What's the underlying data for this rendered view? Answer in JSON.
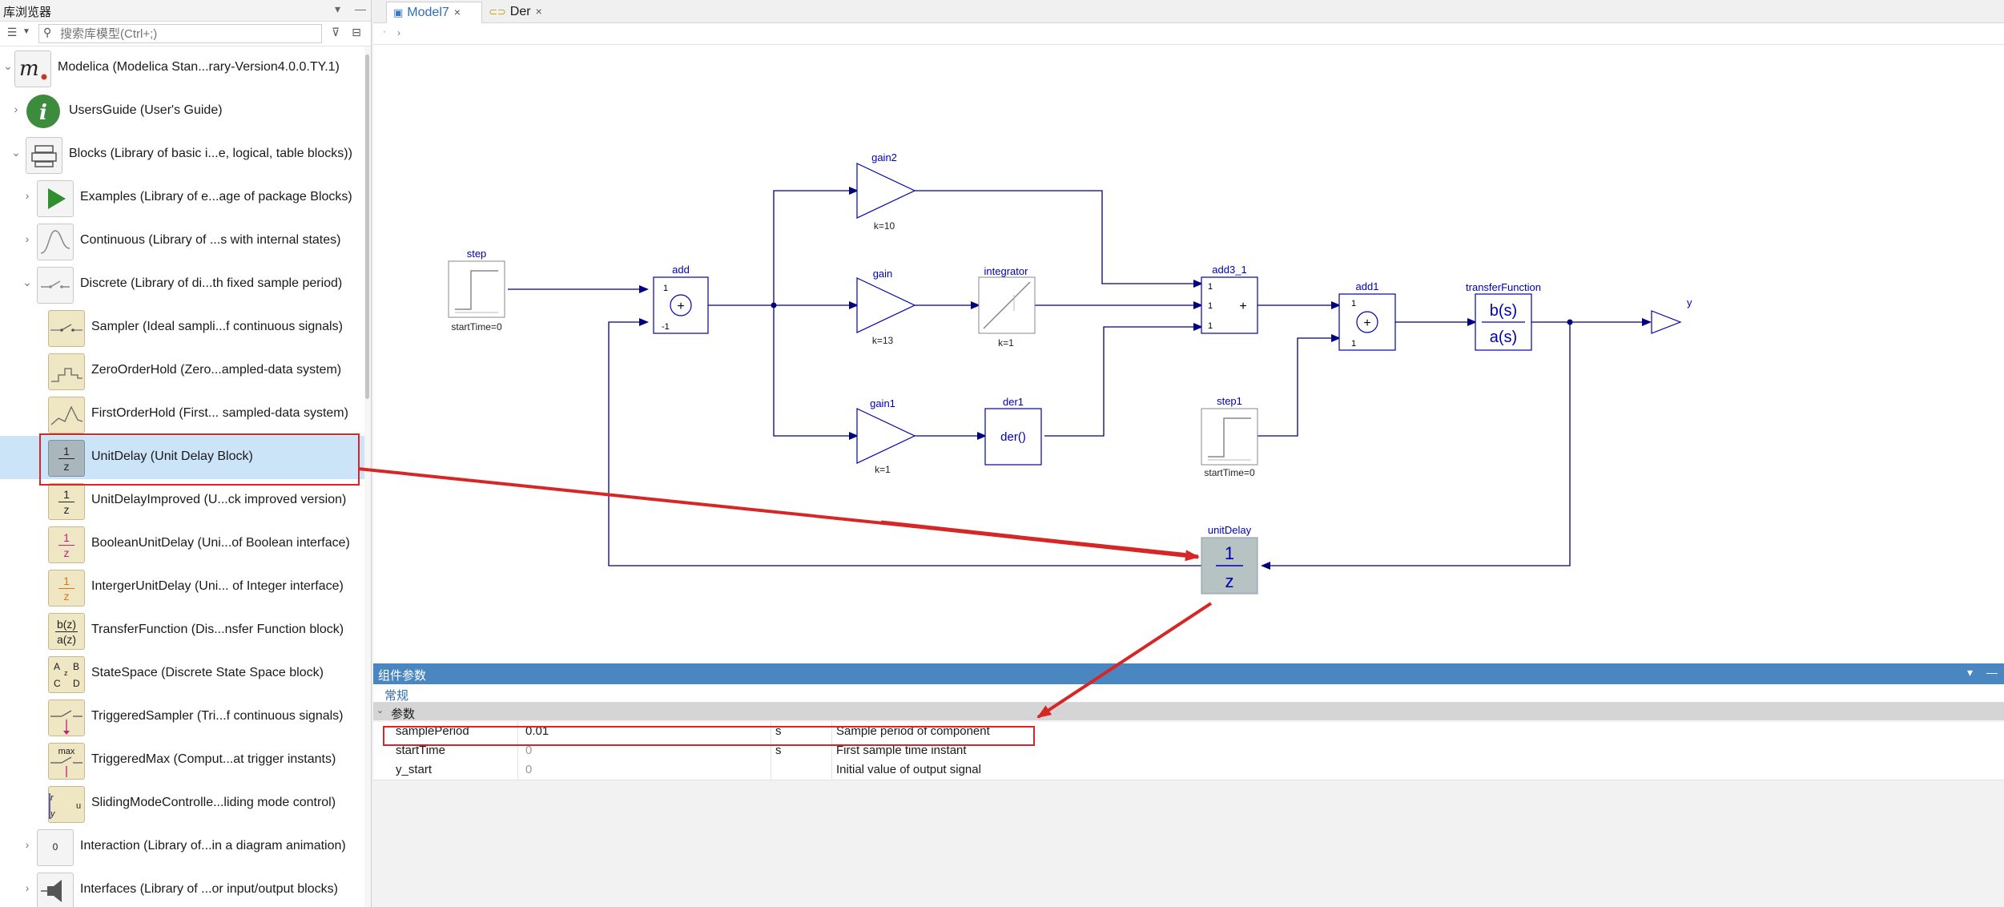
{
  "library": {
    "title": "库浏览器",
    "search_placeholder": "搜索库模型(Ctrl+;)",
    "items": [
      {
        "label": "Modelica (Modelica Stan...rary-Version4.0.0.TY.1)",
        "icon": "modelica-logo-icon",
        "expanded": true
      },
      {
        "label": "UsersGuide (User's Guide)",
        "icon": "info-icon"
      },
      {
        "label": "Blocks (Library of basic i...e, logical, table blocks))",
        "icon": "blocks-package-icon",
        "expanded": true
      },
      {
        "label": "Examples (Library of e...age of package Blocks)",
        "icon": "play-icon"
      },
      {
        "label": "Continuous (Library of ...s with internal states)",
        "icon": "continuous-curve-icon"
      },
      {
        "label": "Discrete (Library of di...th fixed sample period)",
        "icon": "discrete-switch-icon",
        "expanded": true
      },
      {
        "label": "Sampler (Ideal sampli...f continuous signals)",
        "icon": "sampler-icon"
      },
      {
        "label": "ZeroOrderHold (Zero...ampled-data system)",
        "icon": "zero-order-hold-icon"
      },
      {
        "label": "FirstOrderHold (First... sampled-data system)",
        "icon": "first-order-hold-icon"
      },
      {
        "label": "UnitDelay (Unit Delay Block)",
        "icon": "unit-delay-icon",
        "selected": true
      },
      {
        "label": "UnitDelayImproved (U...ck improved version)",
        "icon": "unit-delay-improved-icon"
      },
      {
        "label": "BooleanUnitDelay (Uni...of Boolean interface)",
        "icon": "boolean-unit-delay-icon"
      },
      {
        "label": "IntergerUnitDelay (Uni... of Integer interface)",
        "icon": "integer-unit-delay-icon"
      },
      {
        "label": "TransferFunction (Dis...nsfer Function block)",
        "icon": "transfer-function-icon"
      },
      {
        "label": "StateSpace (Discrete State Space block)",
        "icon": "state-space-icon"
      },
      {
        "label": "TriggeredSampler (Tri...f continuous signals)",
        "icon": "triggered-sampler-icon"
      },
      {
        "label": "TriggeredMax (Comput...at trigger instants)",
        "icon": "triggered-max-icon"
      },
      {
        "label": "SlidingModeControlle...liding mode control)",
        "icon": "sliding-mode-icon"
      },
      {
        "label": "Interaction (Library of...in a diagram animation)",
        "icon": "interaction-icon"
      },
      {
        "label": "Interfaces (Library of ...or input/output blocks)",
        "icon": "interfaces-icon"
      }
    ],
    "icon_text": {
      "unit_delay_num": "1",
      "unit_delay_den": "z",
      "tf_num": "b(z)",
      "tf_den": "a(z)",
      "ss_a": "A",
      "ss_b": "B",
      "ss_c": "C",
      "ss_d": "D",
      "ss_z": "z",
      "max": "max",
      "interaction_zero": "0"
    }
  },
  "tabs": [
    {
      "label": "Model7",
      "active": true,
      "icon": "model-icon"
    },
    {
      "label": "Der",
      "active": false,
      "icon": "function-icon"
    }
  ],
  "diagram": {
    "blocks": {
      "step": {
        "name": "step",
        "param": "startTime=0"
      },
      "add": {
        "name": "add",
        "in1": "1",
        "in2": "-1",
        "op": "+"
      },
      "gain2": {
        "name": "gain2",
        "param": "k=10"
      },
      "gain": {
        "name": "gain",
        "param": "k=13"
      },
      "gain1": {
        "name": "gain1",
        "param": "k=1"
      },
      "integrator": {
        "name": "integrator",
        "param": "k=1"
      },
      "der1": {
        "name": "der1",
        "text": "der()"
      },
      "add3_1": {
        "name": "add3_1",
        "in1": "1",
        "in2": "1",
        "in3": "1",
        "op": "+"
      },
      "step1": {
        "name": "step1",
        "param": "startTime=0"
      },
      "add1": {
        "name": "add1",
        "in1": "1",
        "in2": "1",
        "op": "+"
      },
      "transferFunction": {
        "name": "transferFunction",
        "num": "b(s)",
        "den": "a(s)"
      },
      "y": {
        "name": "y"
      },
      "unitDelay": {
        "name": "unitDelay",
        "num": "1",
        "den": "z"
      }
    }
  },
  "params": {
    "header": "组件参数",
    "tab": "常规",
    "group": "参数",
    "rows": [
      {
        "name": "samplePeriod",
        "value": "0.01",
        "unit": "s",
        "desc": "Sample period of component"
      },
      {
        "name": "startTime",
        "value": "0",
        "unit": "s",
        "desc": "First sample time instant"
      },
      {
        "name": "y_start",
        "value": "0",
        "unit": "",
        "desc": "Initial value of output signal"
      }
    ]
  },
  "colors": {
    "diagram": "#0000b3",
    "wire": "#00007f",
    "highlight": "#d72626",
    "selection": "#cce4f7",
    "panel_header": "#4a87c1"
  }
}
